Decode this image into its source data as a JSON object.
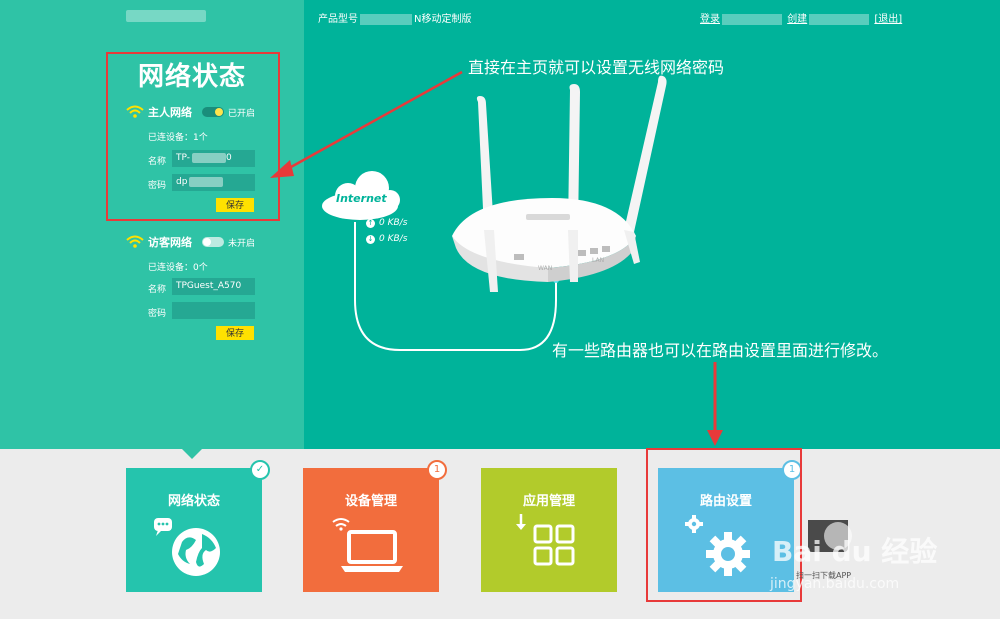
{
  "topbar": {
    "model_label": "产品型号",
    "model_suffix": "N移动定制版",
    "login_label": "登录",
    "create_label": "创建",
    "logout_label": "[退出]"
  },
  "status_panel": {
    "title": "网络状态",
    "main": {
      "name": "主人网络",
      "toggle_state": "已开启",
      "devices": "已连设备：1个",
      "name_label": "名称",
      "name_value": "TP-",
      "name_value_tail": "0",
      "pwd_label": "密码",
      "pwd_value": "dp",
      "save": "保存"
    },
    "guest": {
      "name": "访客网络",
      "toggle_state": "未开启",
      "devices": "已连设备：0个",
      "name_label": "名称",
      "name_value": "TPGuest_A570",
      "pwd_label": "密码",
      "pwd_value": "",
      "save": "保存"
    }
  },
  "diagram": {
    "cloud_label": "Internet",
    "up_rate": "0 KB/s",
    "down_rate": "0 KB/s",
    "router_port_wan": "WAN",
    "router_port_lan": "LAN"
  },
  "annotations": {
    "top": "直接在主页就可以设置无线网络密码",
    "bottom": "有一些路由器也可以在路由设置里面进行修改。"
  },
  "tiles": [
    {
      "label": "网络状态",
      "color": "#25c4ad",
      "badge": "✓",
      "icon": "globe-icon"
    },
    {
      "label": "设备管理",
      "color": "#f26d3d",
      "badge": "1",
      "icon": "laptop-icon"
    },
    {
      "label": "应用管理",
      "color": "#b2cb2b",
      "badge": "",
      "icon": "apps-icon"
    },
    {
      "label": "路由设置",
      "color": "#5cbfe4",
      "badge": "1",
      "icon": "gear-icon"
    }
  ],
  "watermark": {
    "brand": "Bai du 经验",
    "url": "jingyan.baidu.com",
    "scan_text": "扫一扫下载APP"
  }
}
